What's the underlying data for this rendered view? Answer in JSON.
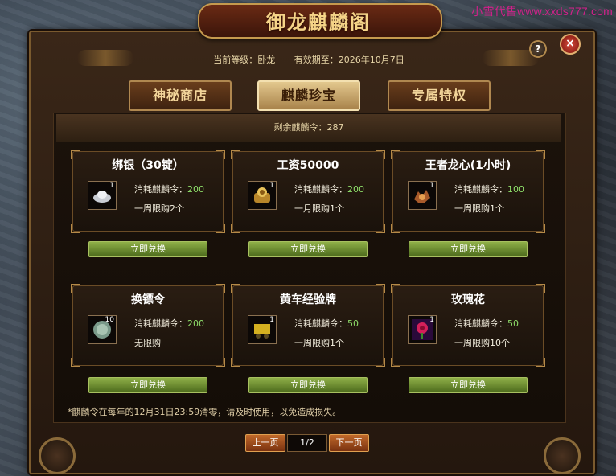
{
  "watermark": "小雪代售www.xxds777.com",
  "window": {
    "title": "御龙麒麟阁"
  },
  "info": {
    "level": "当前等级：卧龙",
    "expiry": "有效期至：2026年10月7日"
  },
  "tabs": [
    {
      "label": "神秘商店"
    },
    {
      "label": "麒麟珍宝"
    },
    {
      "label": "专属特权"
    }
  ],
  "active_tab": "麒麟珍宝",
  "remain": "剩余麒麟令：287",
  "cost_prefix": "消耗麒麟令：",
  "items": [
    {
      "name": "绑银（30锭）",
      "qty": "1",
      "cost": "200",
      "limit": "一周限购2个",
      "button": "立即兑换",
      "icon": "silver-ingot-icon"
    },
    {
      "name": "工资50000",
      "qty": "1",
      "cost": "200",
      "limit": "一月限购1个",
      "button": "立即兑换",
      "icon": "coin-pouch-icon"
    },
    {
      "name": "王者龙心(1小时)",
      "qty": "1",
      "cost": "100",
      "limit": "一周限购1个",
      "button": "立即兑换",
      "icon": "dragon-heart-icon"
    },
    {
      "name": "换镖令",
      "qty": "10",
      "cost": "200",
      "limit": "无限购",
      "button": "立即兑换",
      "icon": "token-icon"
    },
    {
      "name": "黄车经验牌",
      "qty": "1",
      "cost": "50",
      "limit": "一周限购1个",
      "button": "立即兑换",
      "icon": "yellow-cart-icon"
    },
    {
      "name": "玫瑰花",
      "qty": "1",
      "cost": "50",
      "limit": "一周限购10个",
      "button": "立即兑换",
      "icon": "rose-icon"
    }
  ],
  "note": "*麒麟令在每年的12月31日23:59清零，请及时使用，以免造成损失。",
  "pager": {
    "prev": "上一页",
    "page": "1/2",
    "next": "下一页"
  },
  "buttons": {
    "close": "×",
    "help": "?"
  },
  "colors": {
    "cost_value": "#8fe06a",
    "buy_button": "#6f9232",
    "page_button": "#a44c1c",
    "active_tab": "#e3c88e"
  }
}
